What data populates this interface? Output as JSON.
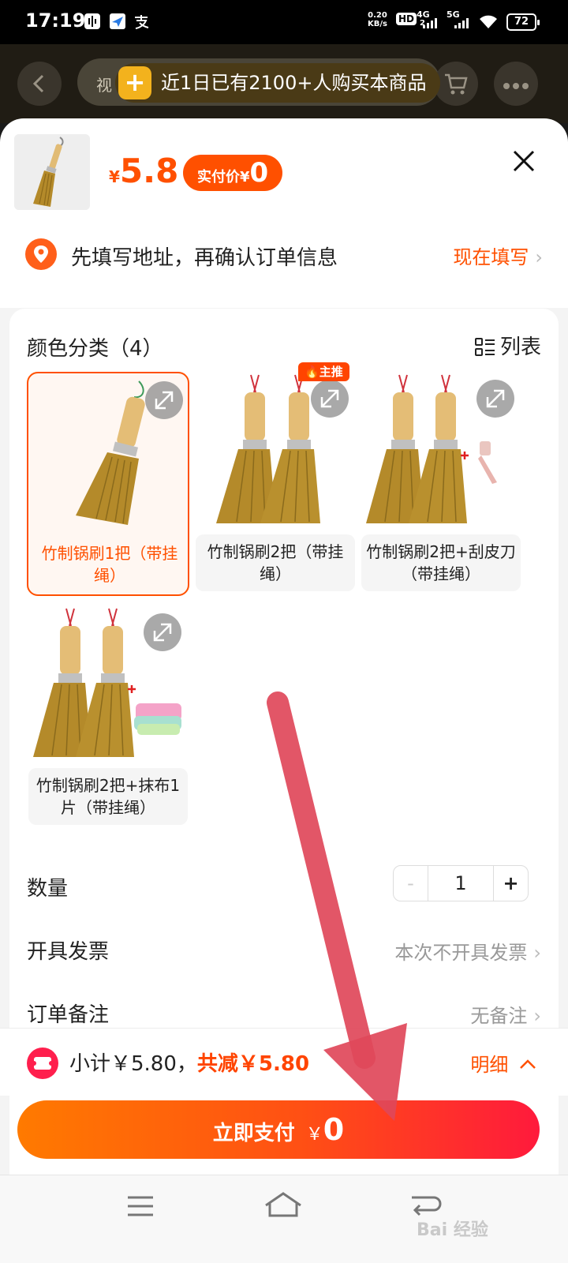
{
  "status_bar": {
    "time": "17:19",
    "net_speed": "0.20",
    "net_unit": "KB/s",
    "hd": "HD",
    "hd_sub": "2",
    "sig1": "4G",
    "sig2": "5G",
    "battery": "72"
  },
  "background_page": {
    "tab_text": "视",
    "toast": "近1日已有2100+人购买本商品"
  },
  "sheet": {
    "price_currency": "¥",
    "price": "5.8",
    "paid_label": "实付价¥",
    "paid_value": "0",
    "address_prompt": "先填写地址，再确认订单信息",
    "address_link": "现在填写",
    "section_title": "颜色分类（4）",
    "list_toggle": "列表",
    "options": [
      {
        "label": "竹制锅刷1把（带挂绳）",
        "selected": true
      },
      {
        "label": "竹制锅刷2把（带挂绳）",
        "badge": "主推"
      },
      {
        "label": "竹制锅刷2把+刮皮刀（带挂绳）"
      },
      {
        "label": "竹制锅刷2把+抹布1片（带挂绳）"
      }
    ],
    "quantity_label": "数量",
    "quantity_minus": "-",
    "quantity_value": "1",
    "quantity_plus": "+",
    "invoice_label": "开具发票",
    "invoice_value": "本次不开具发票",
    "note_label": "订单备注",
    "note_value": "无备注"
  },
  "summary": {
    "subtotal": "小计￥5.80，",
    "discount": "共减￥5.80",
    "detail": "明细"
  },
  "pay_button": {
    "label": "立即支付",
    "currency": "￥",
    "amount": "0"
  },
  "watermark": "Bai 经验",
  "colors": {
    "accent": "#ff5000",
    "pay_gradient_start": "#ff7a00",
    "pay_gradient_end": "#ff1a3c",
    "annotation_arrow": "#e0485a"
  }
}
